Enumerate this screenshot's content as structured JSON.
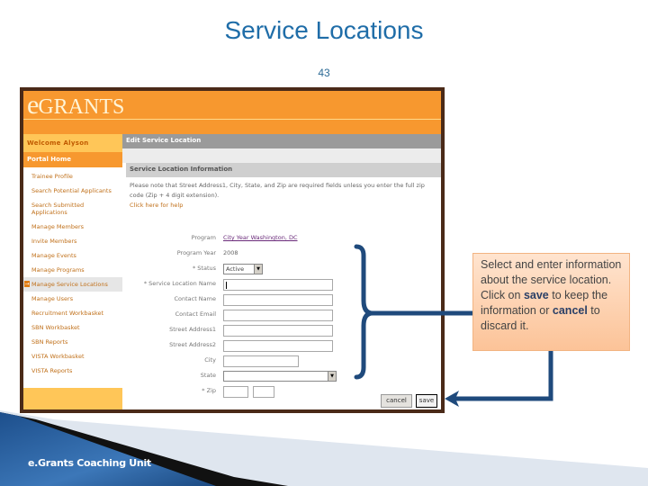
{
  "slide": {
    "title": "Service Locations",
    "number": "43",
    "footer": "e.Grants Coaching Unit"
  },
  "app": {
    "logo_big": "e",
    "logo_rest": "GRANTS",
    "welcome": "Welcome Alyson",
    "portal_home": "Portal Home",
    "sidebar": [
      {
        "label": "Trainee Profile",
        "active": false
      },
      {
        "label": "Search Potential Applicants",
        "active": false
      },
      {
        "label": "Search Submitted",
        "active": false
      },
      {
        "label": "Applications",
        "active": false
      },
      {
        "label": "Manage Members",
        "active": false
      },
      {
        "label": "Invite Members",
        "active": false
      },
      {
        "label": "Manage Events",
        "active": false
      },
      {
        "label": "Manage Programs",
        "active": false
      },
      {
        "label": "Manage Service Locations",
        "active": true
      },
      {
        "label": "Manage Users",
        "active": false
      },
      {
        "label": "Recruitment Workbasket",
        "active": false
      },
      {
        "label": "SBN Workbasket",
        "active": false
      },
      {
        "label": "SBN Reports",
        "active": false
      },
      {
        "label": "VISTA Workbasket",
        "active": false
      },
      {
        "label": "VISTA Reports",
        "active": false
      }
    ],
    "active_arrow": "→",
    "edit_header": "Edit Service Location",
    "section_header": "Service Location Information",
    "notice": "Please note that Street Address1, City, State, and Zip are required fields unless you enter the full zip code (Zip + 4 digit extension).",
    "help_link": "Click here for help",
    "form": {
      "program_label": "Program",
      "program_value": "City Year Washington, DC",
      "year_label": "Program Year",
      "year_value": "2008",
      "status_label": "* Status",
      "status_value": "Active",
      "name_label": "* Service Location Name",
      "name_value": "",
      "contact_name_label": "Contact Name",
      "contact_email_label": "Contact Email",
      "street1_label": "Street Address1",
      "street2_label": "Street Address2",
      "city_label": "City",
      "state_label": "State",
      "state_value": "",
      "zip_label": "* Zip"
    },
    "buttons": {
      "cancel": "cancel",
      "save": "save"
    }
  },
  "callout": {
    "text_1": "Select and enter information about the service location. Click on ",
    "bold_save": "save",
    "text_2": " to keep the information or ",
    "bold_cancel": "cancel",
    "text_3": " to discard it."
  },
  "colors": {
    "brand_orange": "#f7982f",
    "highlight_yellow": "#ffc658",
    "frame_brown": "#4a2a18",
    "title_blue": "#1f6da8",
    "annotation_navy": "#1f4a7c",
    "callout_fill": "#fcc398"
  }
}
